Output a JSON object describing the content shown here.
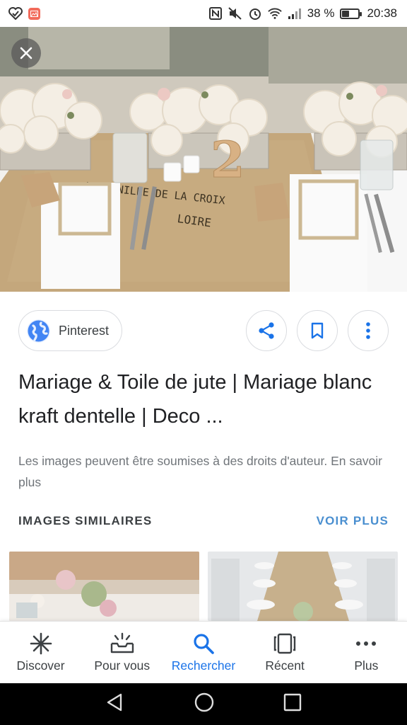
{
  "status_bar": {
    "battery_percent": "38 %",
    "battery_level": 0.38,
    "time": "20:38",
    "icons": [
      "heart-check-icon",
      "gallery-notification-icon",
      "nfc-icon",
      "mute-icon",
      "alarm-icon",
      "wifi-icon",
      "signal-icon",
      "battery-icon"
    ]
  },
  "hero": {
    "table_number": "2",
    "burlap_text_1": "LA VANILLE DE LA CROIX",
    "burlap_text_2": "LOIRE"
  },
  "source": {
    "name": "Pinterest",
    "icon": "globe-icon"
  },
  "actions": [
    "share-icon",
    "bookmark-icon",
    "more-vert-icon"
  ],
  "title": "Mariage & Toile de jute | Mariage blanc kraft dentelle | Deco ...",
  "copyright_notice": "Les images peuvent être soumises à des droits d'auteur. En savoir plus",
  "similar": {
    "heading": "IMAGES SIMILAIRES",
    "see_more": "VOIR PLUS"
  },
  "bottom_nav": [
    {
      "label": "Discover",
      "icon": "asterisk-icon",
      "active": false
    },
    {
      "label": "Pour vous",
      "icon": "inbox-sparkle-icon",
      "active": false
    },
    {
      "label": "Rechercher",
      "icon": "search-icon",
      "active": true
    },
    {
      "label": "Récent",
      "icon": "recent-cards-icon",
      "active": false
    },
    {
      "label": "Plus",
      "icon": "more-horiz-icon",
      "active": false
    }
  ],
  "colors": {
    "accent": "#1a73e8",
    "link": "#4a8fd0",
    "burlap": "#c4a77c"
  }
}
